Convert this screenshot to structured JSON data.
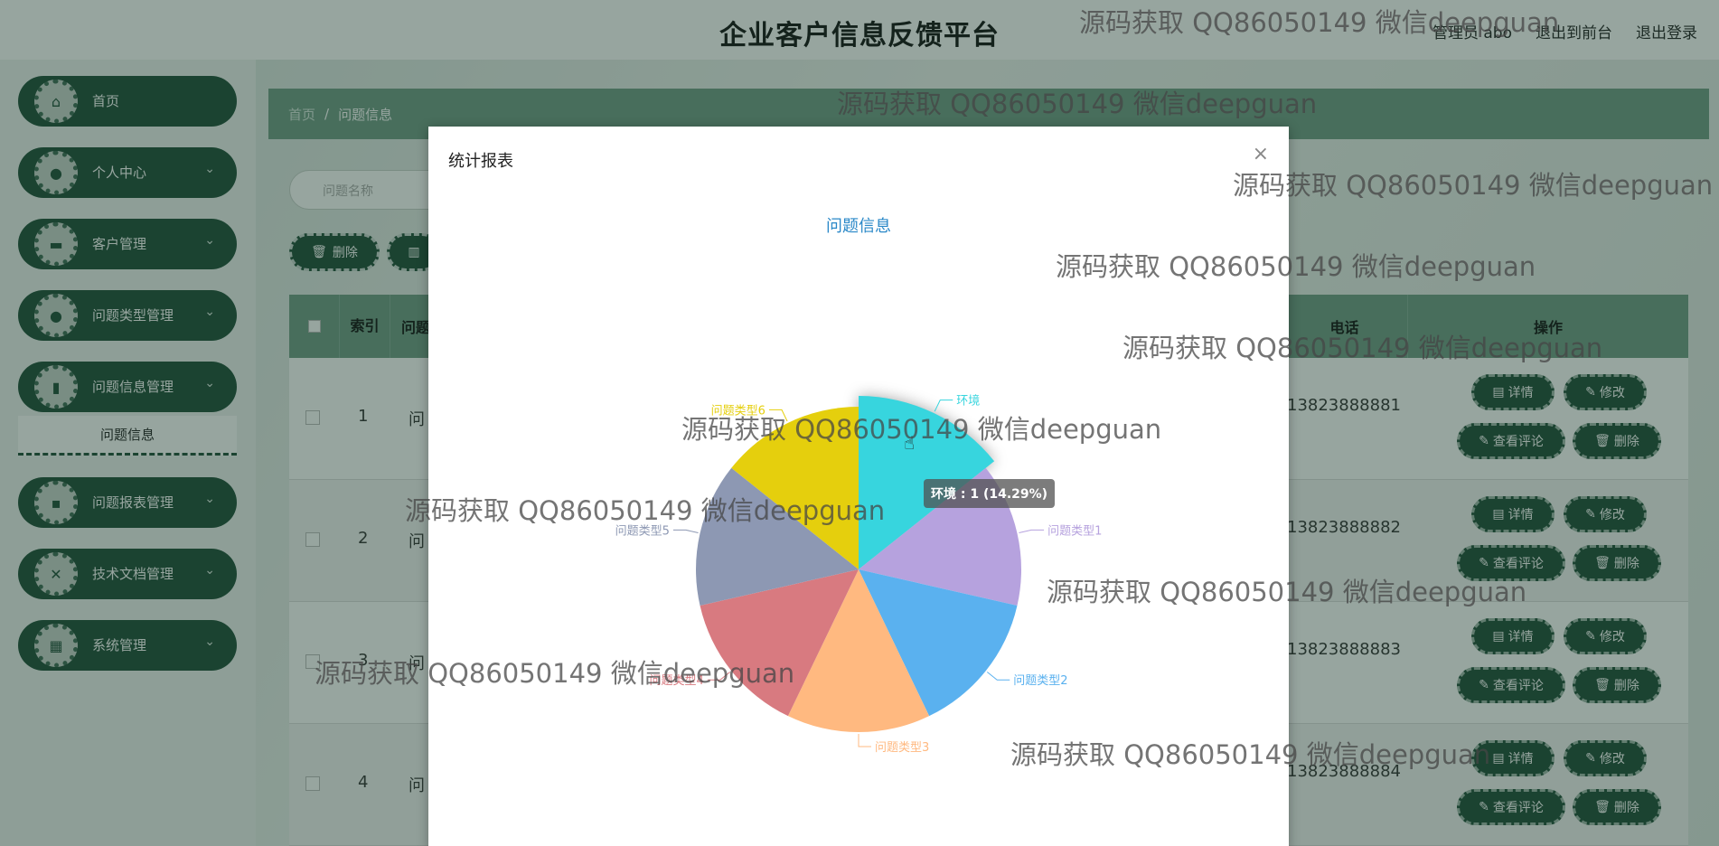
{
  "header": {
    "title": "企业客户信息反馈平台",
    "admin_label": "管理员 abo",
    "front_link": "退出到前台",
    "logout_link": "退出登录"
  },
  "sidebar": {
    "items": [
      {
        "label": "首页",
        "icon": "home-icon",
        "has_children": false
      },
      {
        "label": "个人中心",
        "icon": "user-icon",
        "has_children": true
      },
      {
        "label": "客户管理",
        "icon": "monitor-icon",
        "has_children": true
      },
      {
        "label": "问题类型管理",
        "icon": "user-icon",
        "has_children": true
      },
      {
        "label": "问题信息管理",
        "icon": "book-icon",
        "has_children": true
      },
      {
        "label": "问题报表管理",
        "icon": "chat-icon",
        "has_children": true
      },
      {
        "label": "技术文档管理",
        "icon": "ticket-icon",
        "has_children": true
      },
      {
        "label": "系统管理",
        "icon": "grid-icon",
        "has_children": true
      }
    ],
    "active_submenu": "问题信息"
  },
  "breadcrumb": {
    "home": "首页",
    "separator": "/",
    "current": "问题信息"
  },
  "search": {
    "placeholder": "问题名称"
  },
  "toolbar": {
    "delete_label": "删除"
  },
  "table": {
    "headers": {
      "index": "索引",
      "name": "问题",
      "phone": "电话",
      "ops": "操作"
    },
    "rows": [
      {
        "index": "1",
        "name": "问",
        "phone": "13823888881"
      },
      {
        "index": "2",
        "name": "问",
        "phone": "13823888882"
      },
      {
        "index": "3",
        "name": "问",
        "phone": "13823888883"
      },
      {
        "index": "4",
        "name": "问",
        "phone": "13823888884"
      }
    ],
    "op_labels": {
      "detail": "详情",
      "edit": "修改",
      "comments": "查看评论",
      "delete": "删除"
    }
  },
  "modal": {
    "title": "统计报表",
    "close": "×"
  },
  "chart_data": {
    "type": "pie",
    "title": "问题信息",
    "slices": [
      {
        "name": "环境",
        "value": 1,
        "color": "#37d5de"
      },
      {
        "name": "问题类型1",
        "value": 1,
        "color": "#b6a2de"
      },
      {
        "name": "问题类型2",
        "value": 1,
        "color": "#5ab1ef"
      },
      {
        "name": "问题类型3",
        "value": 1,
        "color": "#ffb980"
      },
      {
        "name": "问题类型4",
        "value": 1,
        "color": "#d87a80"
      },
      {
        "name": "问题类型5",
        "value": 1,
        "color": "#8d98b3"
      },
      {
        "name": "问题类型6",
        "value": 1,
        "color": "#e5cf0d"
      }
    ],
    "tooltip": "环境 : 1 (14.29%)",
    "highlighted": "环境"
  },
  "watermark": "源码获取 QQ86050149 微信deepguan",
  "colors": {
    "primary": "#1e4d38",
    "header_bar": "#6f9b86",
    "chart_title": "#2a88c8"
  }
}
